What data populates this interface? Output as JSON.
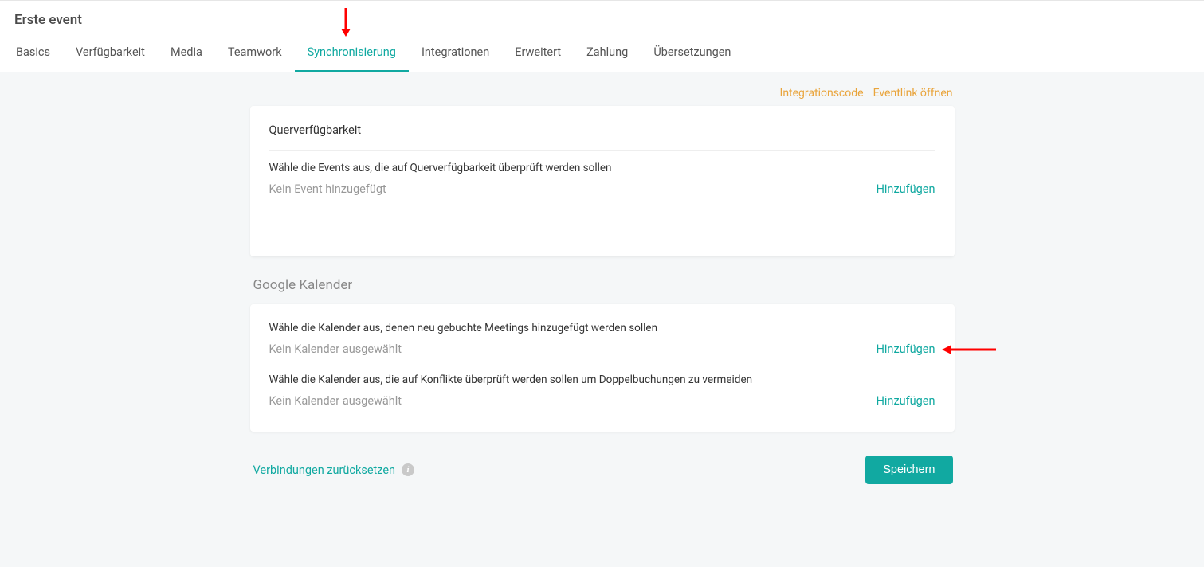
{
  "page_title": "Erste event",
  "tabs": [
    {
      "label": "Basics",
      "active": false
    },
    {
      "label": "Verfügbarkeit",
      "active": false
    },
    {
      "label": "Media",
      "active": false
    },
    {
      "label": "Teamwork",
      "active": false
    },
    {
      "label": "Synchronisierung",
      "active": true
    },
    {
      "label": "Integrationen",
      "active": false
    },
    {
      "label": "Erweitert",
      "active": false
    },
    {
      "label": "Zahlung",
      "active": false
    },
    {
      "label": "Übersetzungen",
      "active": false
    }
  ],
  "top_links": {
    "integration_code": "Integrationscode",
    "open_event_link": "Eventlink öffnen"
  },
  "cross_availability": {
    "title": "Querverfügbarkeit",
    "description": "Wähle die Events aus, die auf Querverfügbarkeit überprüft werden sollen",
    "empty": "Kein Event hinzugefügt",
    "add": "Hinzufügen"
  },
  "google_calendar": {
    "heading": "Google Kalender",
    "add_to": {
      "description": "Wähle die Kalender aus, denen neu gebuchte Meetings hinzugefügt werden sollen",
      "empty": "Kein Kalender ausgewählt",
      "add": "Hinzufügen"
    },
    "conflict": {
      "description": "Wähle die Kalender aus, die auf Konflikte überprüft werden sollen um Doppelbuchungen zu vermeiden",
      "empty": "Kein Kalender ausgewählt",
      "add": "Hinzufügen"
    }
  },
  "footer": {
    "reset": "Verbindungen zurücksetzen",
    "save": "Speichern"
  },
  "colors": {
    "accent": "#11a9a1",
    "warn_link": "#e9a43b",
    "annotation": "#ff0000"
  }
}
